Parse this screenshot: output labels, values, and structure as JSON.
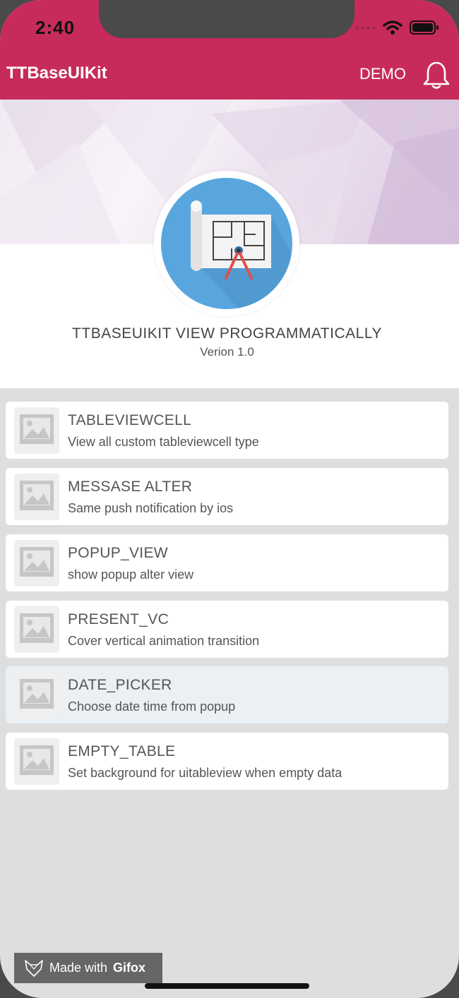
{
  "status_bar": {
    "time": "2:40"
  },
  "nav": {
    "title": "TTBaseUIKit",
    "demo_label": "DEMO"
  },
  "header": {
    "title": "TTBASEUIKIT VIEW PROGRAMMATICALLY",
    "version": "Verion 1.0"
  },
  "items": [
    {
      "title": "TABLEVIEWCELL",
      "subtitle": "View all custom tableviewcell type"
    },
    {
      "title": "MESSASE ALTER",
      "subtitle": "Same push notification by ios"
    },
    {
      "title": "POPUP_VIEW",
      "subtitle": "show popup alter view"
    },
    {
      "title": "PRESENT_VC",
      "subtitle": "Cover vertical animation transition"
    },
    {
      "title": "DATE_PICKER",
      "subtitle": "Choose date time from popup",
      "selected": true
    },
    {
      "title": "EMPTY_TABLE",
      "subtitle": "Set background for uitableview when empty data"
    }
  ],
  "watermark": {
    "prefix": "Made with",
    "brand": "Gifox"
  },
  "colors": {
    "nav_bar": "#c72b5b",
    "logo_circle": "#59a6df",
    "selected_row": "#eaf0f3",
    "background": "#dedede"
  },
  "icons": [
    "wifi-icon",
    "battery-icon",
    "bell-icon",
    "blueprint-logo-icon",
    "image-placeholder-icon",
    "fox-logo-icon"
  ]
}
